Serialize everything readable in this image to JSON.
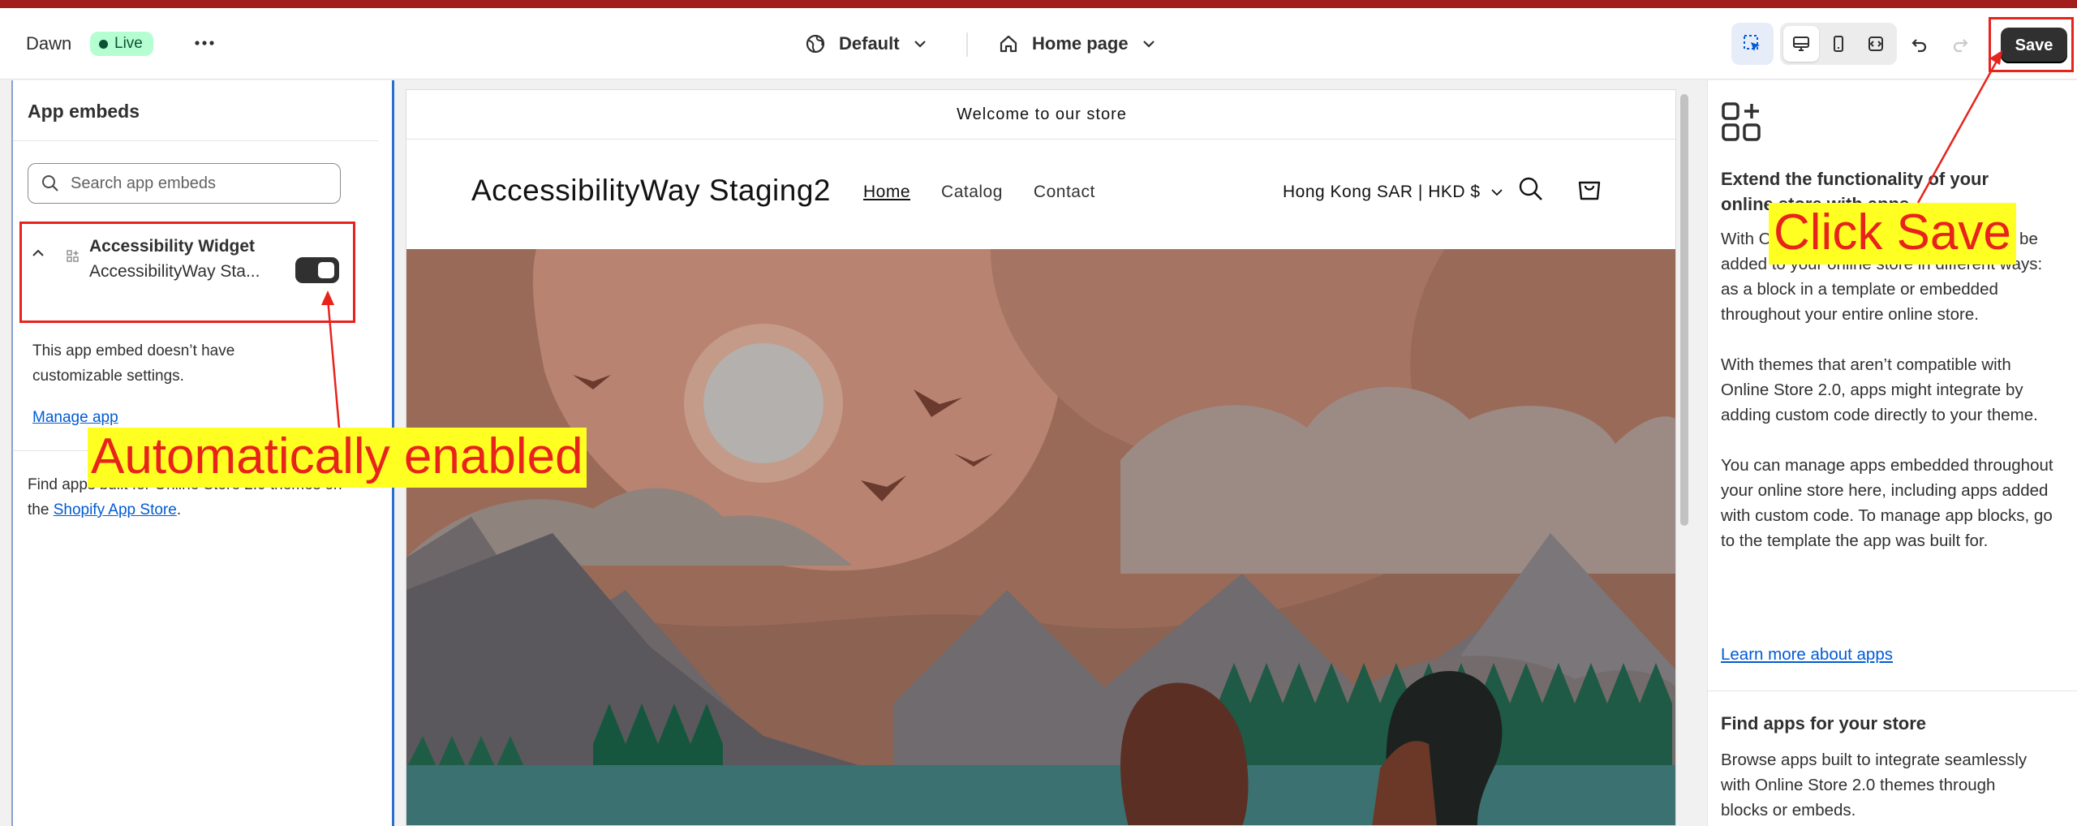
{
  "topbar": {
    "theme_name": "Dawn",
    "status_badge": "Live",
    "theme_selector": "Default",
    "page_selector": "Home page",
    "save_label": "Save"
  },
  "left_panel": {
    "title": "App embeds",
    "search_placeholder": "Search app embeds",
    "embed": {
      "title": "Accessibility Widget",
      "subtitle": "AccessibilityWay Sta...",
      "enabled": true
    },
    "note": "This app embed doesn’t have customizable settings.",
    "manage_link": "Manage app",
    "find_text_prefix": "Find apps built for Online Store 2.0 themes on the ",
    "find_link": "Shopify App Store",
    "find_text_suffix": "."
  },
  "preview": {
    "announcement": "Welcome to our store",
    "store_name": "AccessibilityWay Staging2",
    "nav": [
      "Home",
      "Catalog",
      "Contact"
    ],
    "locale": "Hong Kong SAR | HKD $"
  },
  "right_panel": {
    "heading": "Extend the functionality of your online store with apps",
    "paragraphs": [
      "With Online Store 2.0 themes, apps can be added to your online store in different ways: as a block in a template or embedded throughout your entire online store.",
      "With themes that aren’t compatible with Online Store 2.0, apps might integrate by adding custom code directly to your theme.",
      "You can manage apps embedded throughout your online store here, including apps added with custom code. To manage app blocks, go to the template the app was built for."
    ],
    "learn_link": "Learn more about apps",
    "heading2": "Find apps for your store",
    "body2": "Browse apps built to integrate seamlessly with Online Store 2.0 themes through blocks or embeds."
  },
  "annotations": {
    "auto_enabled": "Automatically enabled",
    "click_save": "Click Save",
    "color": "#e8231c",
    "highlight": "#ffff22"
  }
}
